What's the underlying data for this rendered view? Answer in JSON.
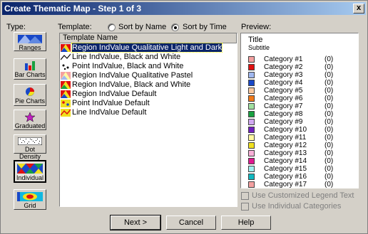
{
  "window": {
    "title": "Create Thematic Map - Step 1 of 3",
    "close_label": "x"
  },
  "type_section": {
    "label": "Type:",
    "buttons": [
      {
        "label": "Ranges",
        "icon": "ranges-icon"
      },
      {
        "label": "Bar Charts",
        "icon": "bar-chart-icon"
      },
      {
        "label": "Pie Charts",
        "icon": "pie-chart-icon"
      },
      {
        "label": "Graduated",
        "icon": "graduated-star-icon"
      },
      {
        "label": "Dot Density",
        "icon": "dot-density-icon"
      },
      {
        "label": "Individual",
        "icon": "individual-icon",
        "selected": true
      },
      {
        "label": "Grid",
        "icon": "grid-icon"
      }
    ]
  },
  "template_section": {
    "label": "Template:",
    "sort_by_name": "Sort by Name",
    "sort_by_time": "Sort by Time",
    "sort_selected": "time",
    "column_header": "Template Name",
    "items": [
      {
        "name": "Region IndValue Qualitative Light and Dark",
        "selected": true
      },
      {
        "name": "Line IndValue, Black and White"
      },
      {
        "name": "Point IndValue, Black and White"
      },
      {
        "name": "Region IndValue Qualitative Pastel"
      },
      {
        "name": "Region IndValue, Black and White"
      },
      {
        "name": "Region IndValue Default"
      },
      {
        "name": "Point IndValue Default"
      },
      {
        "name": "Line IndValue Default"
      }
    ]
  },
  "preview": {
    "label": "Preview:",
    "title": "Title",
    "subtitle": "Subtitle",
    "legend": [
      {
        "label": "Category #1",
        "count": "(0)",
        "color": "#f4a0a0"
      },
      {
        "label": "Category #2",
        "count": "(0)",
        "color": "#e01010"
      },
      {
        "label": "Category #3",
        "count": "(0)",
        "color": "#a0b8f0"
      },
      {
        "label": "Category #4",
        "count": "(0)",
        "color": "#1848c8"
      },
      {
        "label": "Category #5",
        "count": "(0)",
        "color": "#f8c8a0"
      },
      {
        "label": "Category #6",
        "count": "(0)",
        "color": "#f07818"
      },
      {
        "label": "Category #7",
        "count": "(0)",
        "color": "#a0e0a0"
      },
      {
        "label": "Category #8",
        "count": "(0)",
        "color": "#18a040"
      },
      {
        "label": "Category #9",
        "count": "(0)",
        "color": "#d0a8f0"
      },
      {
        "label": "Category #10",
        "count": "(0)",
        "color": "#7020c0"
      },
      {
        "label": "Category #11",
        "count": "(0)",
        "color": "#fff8a0"
      },
      {
        "label": "Category #12",
        "count": "(0)",
        "color": "#f0e020"
      },
      {
        "label": "Category #13",
        "count": "(0)",
        "color": "#f8b0d8"
      },
      {
        "label": "Category #14",
        "count": "(0)",
        "color": "#e01890"
      },
      {
        "label": "Category #15",
        "count": "(0)",
        "color": "#a0f0f0"
      },
      {
        "label": "Category #16",
        "count": "(0)",
        "color": "#10b8c0"
      },
      {
        "label": "Category #17",
        "count": "(0)",
        "color": "#f4a0a0"
      }
    ]
  },
  "options": {
    "use_customized_legend_text": "Use Customized Legend Text",
    "use_individual_categories": "Use Individual Categories"
  },
  "buttons": {
    "next": "Next >",
    "cancel": "Cancel",
    "help": "Help"
  }
}
